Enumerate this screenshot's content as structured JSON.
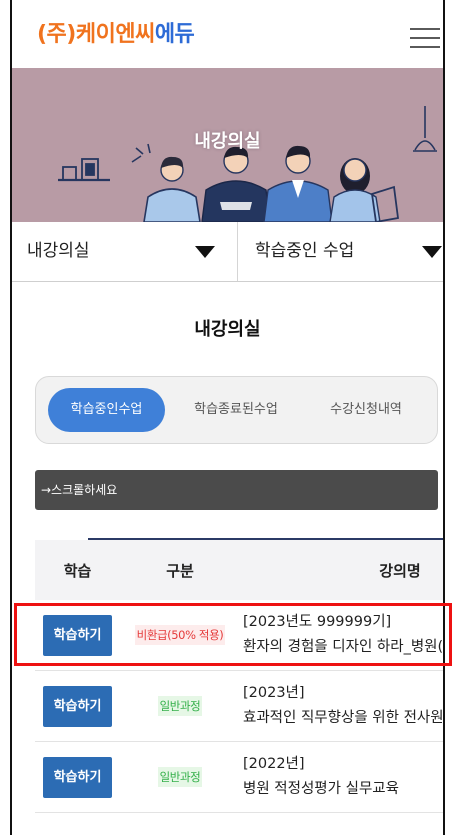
{
  "brand": {
    "name_part1": "(주)케이엔씨",
    "name_part2": "에듀",
    "color_part1": "#f0731e",
    "color_part2": "#2d6bd6"
  },
  "header": {
    "menu_icon": "hamburger-icon"
  },
  "banner": {
    "title": "내강의실",
    "background": "#b89ba5"
  },
  "selectors": [
    {
      "value": "내강의실",
      "icon": "caret-down-icon"
    },
    {
      "value": "학습중인 수업",
      "icon": "caret-down-icon"
    }
  ],
  "section": {
    "title": "내강의실"
  },
  "tabs": {
    "active_color": "#3f80d8",
    "items": [
      {
        "label": "학습중인수업",
        "active": true
      },
      {
        "label": "학습종료된수업",
        "active": false
      },
      {
        "label": "수강신청내역",
        "active": false
      }
    ]
  },
  "scroll_hint": {
    "text": "→스크롤하세요"
  },
  "table": {
    "columns": [
      "학습",
      "구분",
      "강의명"
    ],
    "button_color": "#2c6cb4",
    "rows": [
      {
        "action": "학습하기",
        "category": "비환급(50% 적용)",
        "category_color": "#e53b3b",
        "category_bg": "#fdecec",
        "title_line1": "[2023년도 999999기]",
        "title_line2": "환자의 경험을 디자인 하라_병원(",
        "highlighted": true
      },
      {
        "action": "학습하기",
        "category": "일반과정",
        "category_color": "#34b04a",
        "category_bg": "#e6f7e6",
        "title_line1": "[2023년]",
        "title_line2": "효과적인 직무향상을 위한 전사원",
        "highlighted": false
      },
      {
        "action": "학습하기",
        "category": "일반과정",
        "category_color": "#34b04a",
        "category_bg": "#e6f7e6",
        "title_line1": "[2022년]",
        "title_line2": "병원 적정성평가 실무교육",
        "highlighted": false
      }
    ]
  },
  "highlight": {
    "color": "#ee1111"
  }
}
